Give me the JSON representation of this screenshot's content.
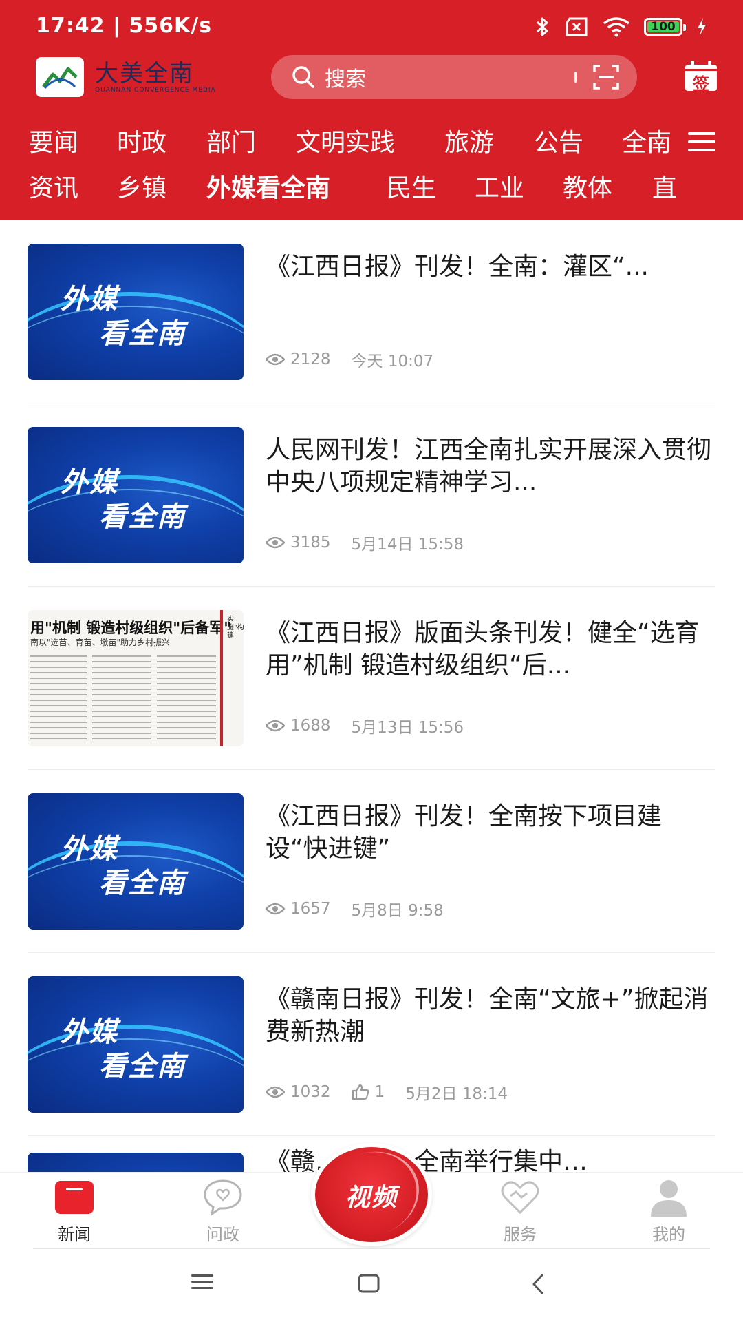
{
  "status_bar": {
    "time_speed": "17:42 | 556K/s",
    "battery": "100"
  },
  "header": {
    "brand_name": "大美全南",
    "brand_sub": "QUANNAN CONVERGENCE MEDIA",
    "search_placeholder": "搜索",
    "signin_label": "签"
  },
  "nav": {
    "row1": [
      "要闻",
      "时政",
      "部门",
      "文明实践",
      "旅游",
      "公告",
      "全南"
    ],
    "row2": [
      "资讯",
      "乡镇",
      "外媒看全南",
      "民生",
      "工业",
      "教体",
      "直"
    ],
    "active": "外媒看全南"
  },
  "thumb_text": {
    "line1": "外媒",
    "line2": "看全南"
  },
  "paper_thumb": {
    "headline": "用\"机制 锻造村级组织\"后备军\"",
    "subline": "南以\"选苗、育苗、墩苗\"助力乡村振兴",
    "side_text": "实施\"构建"
  },
  "news": [
    {
      "title": "《江西日报》刊发！全南：灌区“...",
      "views": "2128",
      "time": "今天 10:07",
      "likes": ""
    },
    {
      "title": "人民网刊发！江西全南扎实开展深入贯彻中央八项规定精神学习...",
      "views": "3185",
      "time": "5月14日 15:58",
      "likes": ""
    },
    {
      "title": "《江西日报》版面头条刊发！健全“选育用”机制 锻造村级组织“后...",
      "views": "1688",
      "time": "5月13日 15:56",
      "likes": ""
    },
    {
      "title": "《江西日报》刊发！全南按下项目建设“快进键”",
      "views": "1657",
      "time": "5月8日 9:58",
      "likes": ""
    },
    {
      "title": "《赣南日报》刊发！全南“文旅+”掀起消费新热潮",
      "views": "1032",
      "time": "5月2日 18:14",
      "likes": "1"
    },
    {
      "title": "《赣…刊发！全南举行集中…",
      "views": "",
      "time": "",
      "likes": ""
    }
  ],
  "tabbar": {
    "news": "新闻",
    "wenzheng": "问政",
    "video": "视频",
    "service": "服务",
    "mine": "我的"
  },
  "colors": {
    "brand_red": "#d61f26",
    "meta_gray": "#9a9a9a",
    "thumb_blue": "#0f3fa8"
  }
}
